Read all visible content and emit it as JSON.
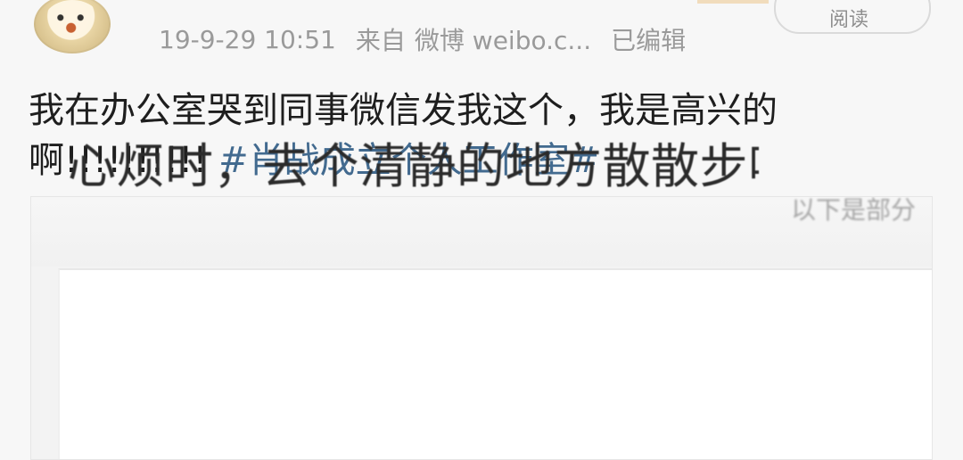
{
  "header": {
    "timestamp": "19-9-29 10:51",
    "source_prefix": "来自",
    "source_name": "微博 weibo.c...",
    "edited": "已编辑",
    "read_button": "阅读"
  },
  "post": {
    "line1": "我在办公室哭到同事微信发我这个，我是高兴的",
    "line2_prefix": "啊!!!!!!!!!!",
    "hashtag": "#肖战成立个人工作室#"
  },
  "image": {
    "top_text": "以下是部分",
    "main_text": "心烦时，去个清静的地方散散步",
    "cutoff_char": "吧"
  },
  "icons": {
    "avatar": "user-avatar-icon"
  }
}
